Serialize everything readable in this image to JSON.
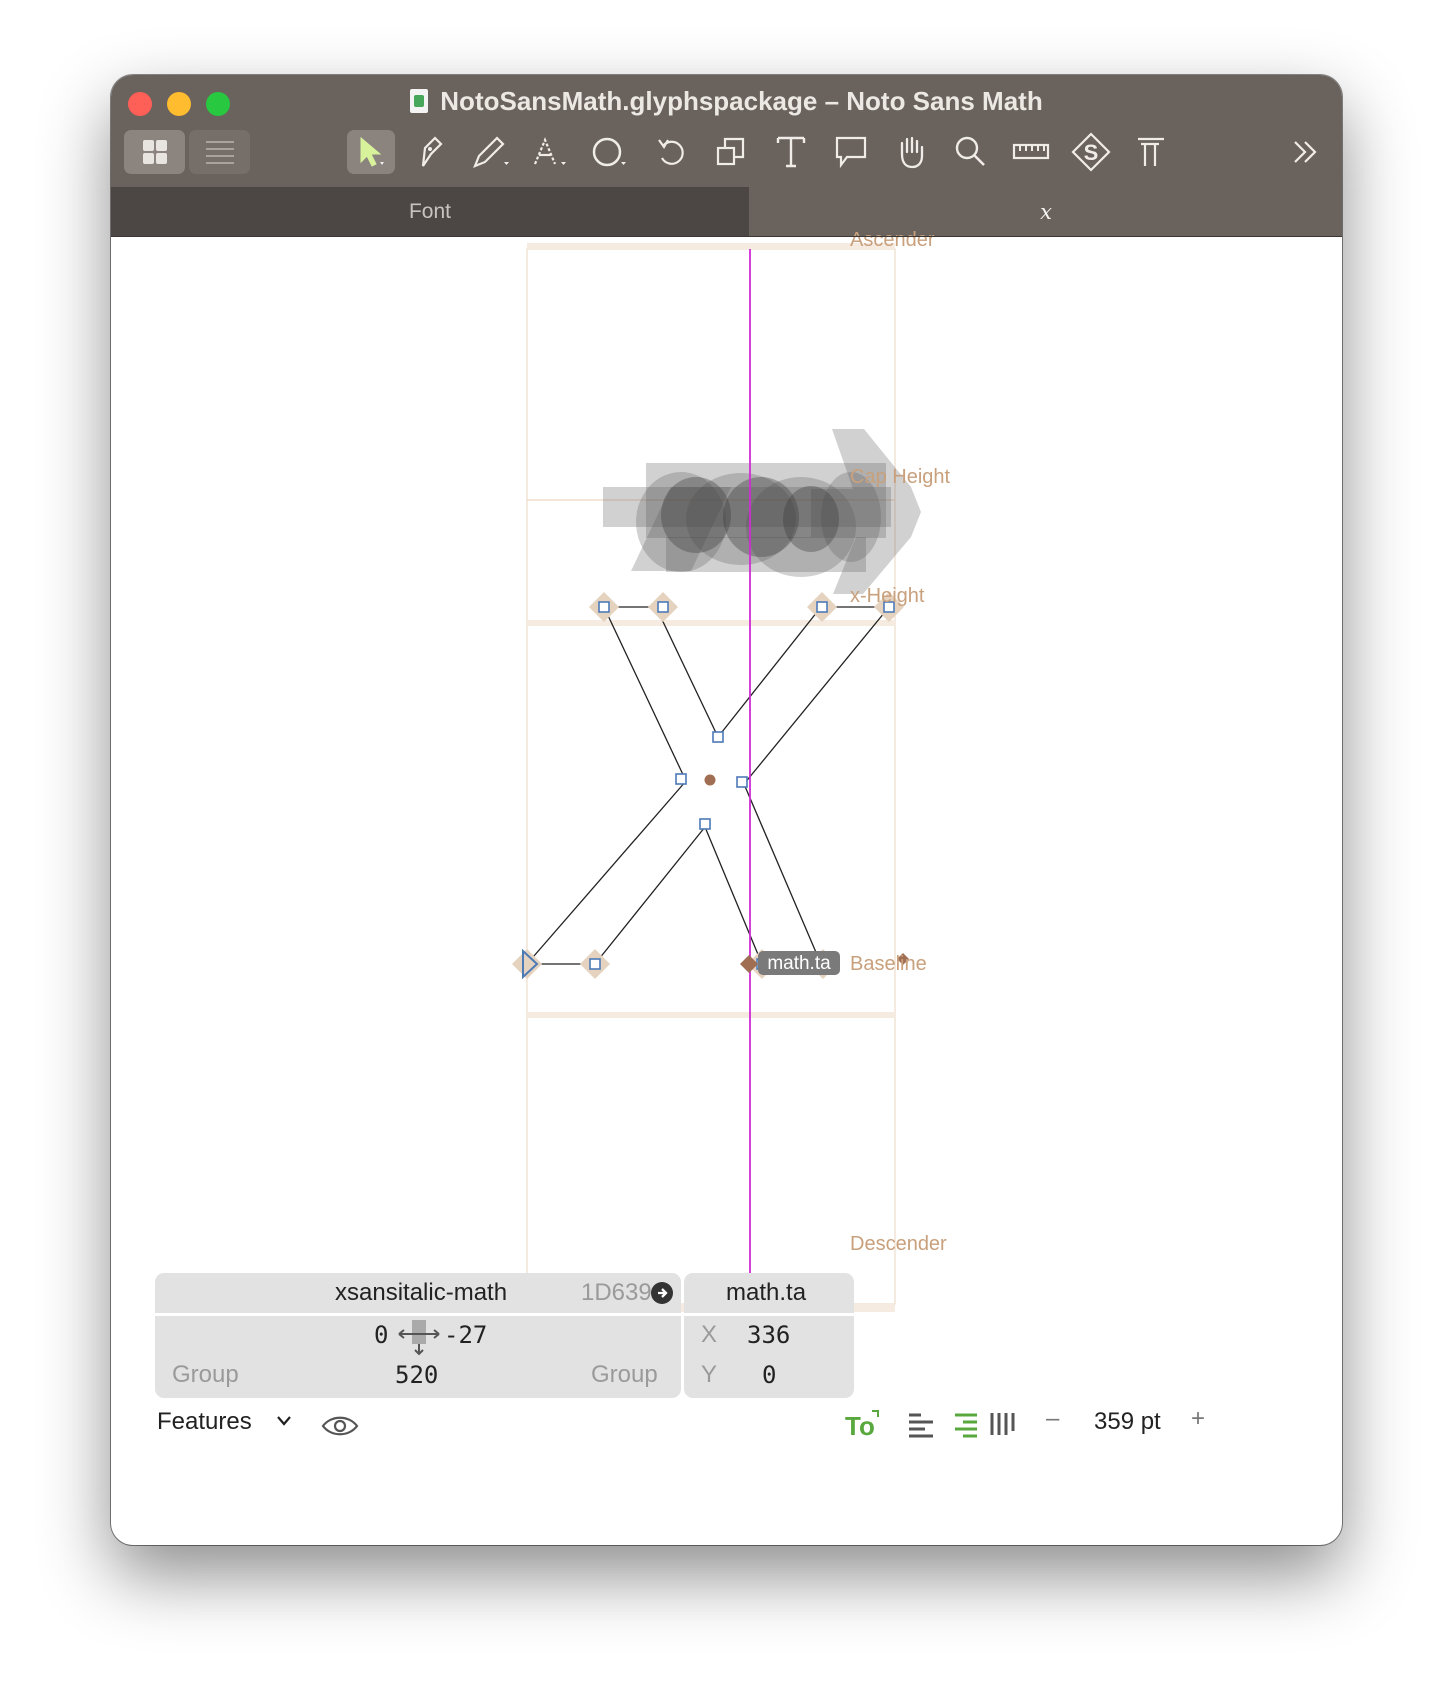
{
  "window": {
    "title": "NotoSansMath.glyphspackage – Noto Sans Math",
    "tabs": [
      "Font",
      "x"
    ]
  },
  "toolbar": {
    "tools": [
      "select-tool",
      "draw-tool",
      "pencil-tool",
      "primitives-tool",
      "shape-tool",
      "rotate-tool",
      "scale-tool",
      "text-tool",
      "annotation-tool",
      "hand-tool",
      "zoom-tool",
      "measure-tool",
      "symmetry-tool",
      "metrics-tool",
      "more-tools"
    ]
  },
  "metrics": {
    "ascender": "Ascender",
    "cap_height": "Cap Height",
    "x_height": "x-Height",
    "baseline": "Baseline",
    "descender": "Descender"
  },
  "anchor_label": "math.ta",
  "info_panel": {
    "glyph_name": "xsansitalic-math",
    "unicode": "1D639+",
    "lsb": "0",
    "rsb": "-27",
    "width": "520",
    "left_group": "Group",
    "right_group": "Group",
    "selection_name": "math.ta",
    "x_label": "X",
    "x_value": "336",
    "y_label": "Y",
    "y_value": "0"
  },
  "bottom_bar": {
    "features_label": "Features",
    "zoom_value": "359 pt",
    "zoom_minus": "–",
    "zoom_plus": "+"
  },
  "colors": {
    "titlebar": "#6a625d",
    "metric_line": "#f3e6da",
    "metric_label": "#c8a07c",
    "center_line": "#d12bd6",
    "node_blue": "#4e7ab8",
    "anchor_brown": "#a06e52",
    "accent_green": "#58a83e"
  }
}
